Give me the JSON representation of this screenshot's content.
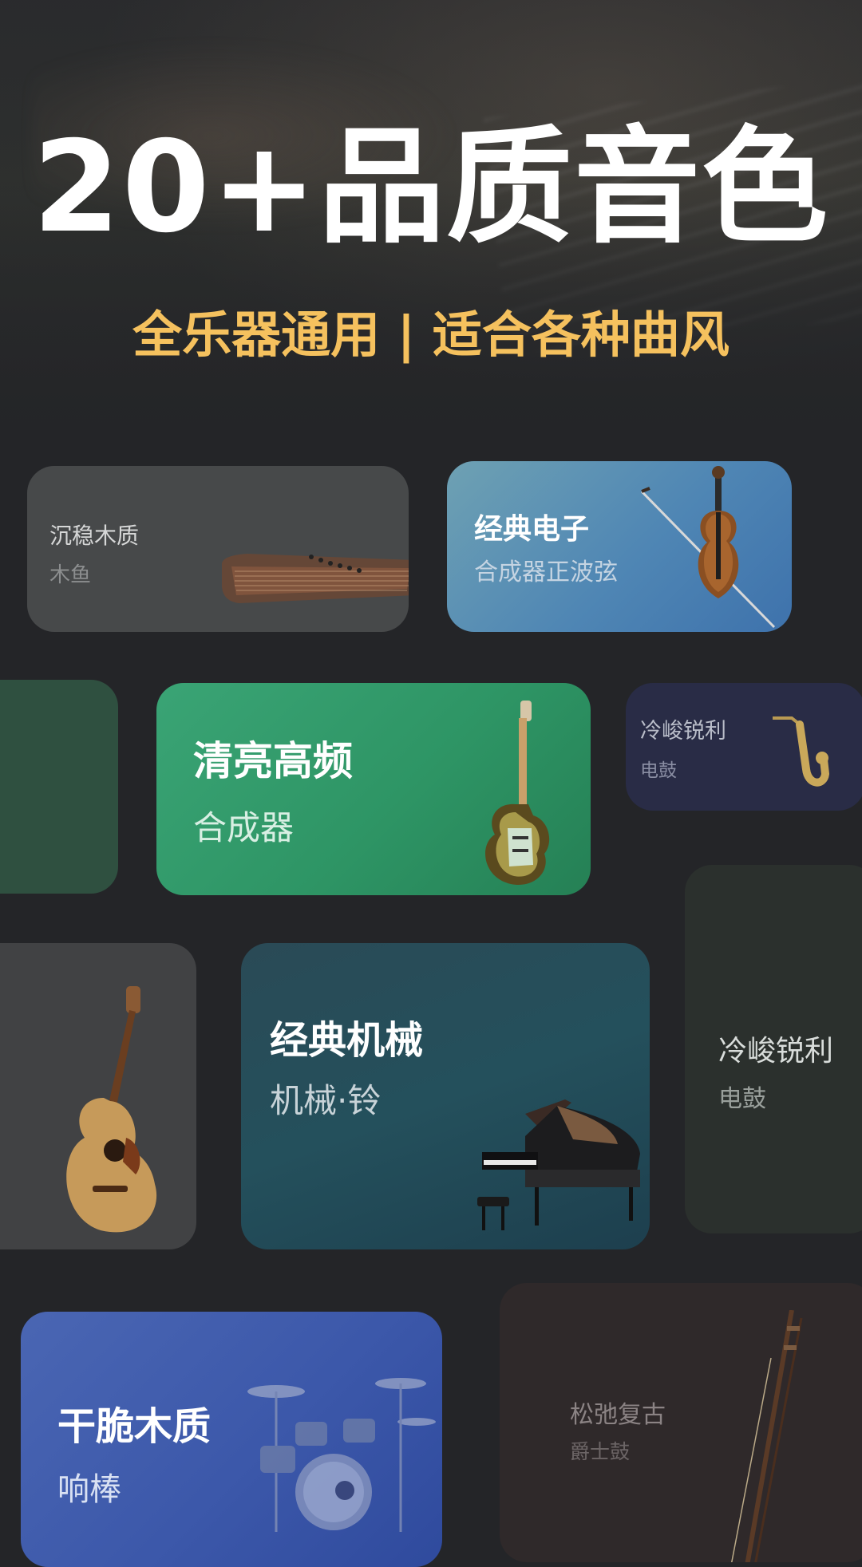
{
  "hero": {
    "title": "20+品质音色",
    "subtitle": "全乐器通用 | 适合各种曲风"
  },
  "cards": [
    {
      "title": "沉稳木质",
      "subtitle": "木鱼",
      "instrument_icon": "guzheng-icon",
      "color": "#47494a"
    },
    {
      "title": "经典电子",
      "subtitle": "合成器正波弦",
      "instrument_icon": "violin-icon",
      "color": "#4f86b4"
    },
    {
      "title": "清亮高频",
      "subtitle": "合成器",
      "instrument_icon": "electric-guitar-icon",
      "color": "#2e9565"
    },
    {
      "title": "冷峻锐利",
      "subtitle": "电鼓",
      "instrument_icon": "saxophone-icon",
      "color": "#292c46"
    },
    {
      "title": "",
      "subtitle": "",
      "instrument_icon": "acoustic-guitar-icon",
      "color": "#414244"
    },
    {
      "title": "经典机械",
      "subtitle": "机械·铃",
      "instrument_icon": "grand-piano-icon",
      "color": "#24505c"
    },
    {
      "title": "冷峻锐利",
      "subtitle": "电鼓",
      "instrument_icon": "",
      "color": "#2b302d"
    },
    {
      "title": "干脆木质",
      "subtitle": "响棒",
      "instrument_icon": "drum-kit-icon",
      "color": "#3c58aa"
    },
    {
      "title": "松弛复古",
      "subtitle": "爵士鼓",
      "instrument_icon": "erhu-icon",
      "color": "#2f292a"
    }
  ],
  "colors": {
    "accent": "#f5c15e",
    "background": "#242528"
  }
}
